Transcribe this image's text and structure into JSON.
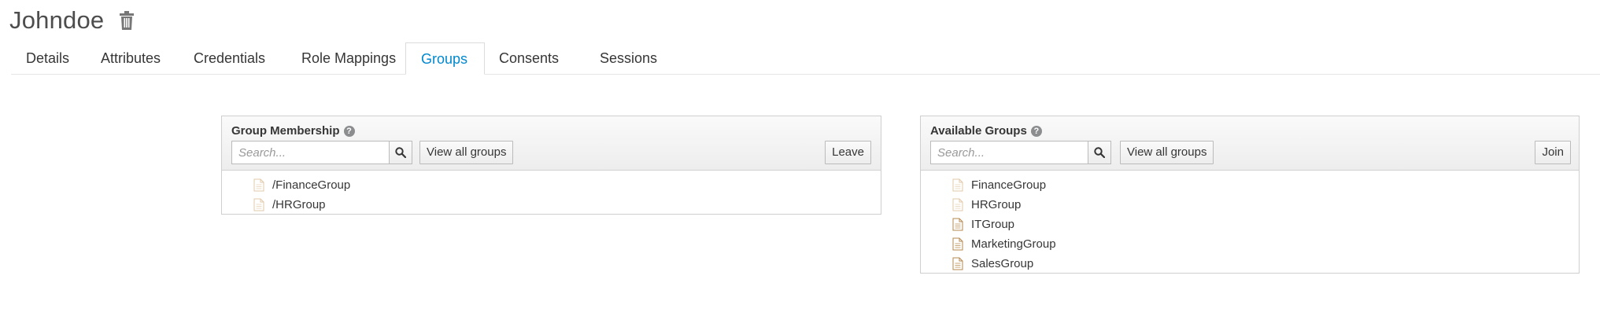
{
  "header": {
    "title": "Johndoe",
    "delete_icon": "trash-icon"
  },
  "tabs": [
    {
      "label": "Details",
      "active": false
    },
    {
      "label": "Attributes",
      "active": false
    },
    {
      "label": "Credentials",
      "active": false
    },
    {
      "label": "Role Mappings",
      "active": false
    },
    {
      "label": "Groups",
      "active": true
    },
    {
      "label": "Consents",
      "active": false
    },
    {
      "label": "Sessions",
      "active": false
    }
  ],
  "membership": {
    "title": "Group Membership",
    "search_placeholder": "Search...",
    "view_all_label": "View all groups",
    "action_label": "Leave",
    "items": [
      "/FinanceGroup",
      "/HRGroup"
    ]
  },
  "available": {
    "title": "Available Groups",
    "search_placeholder": "Search...",
    "view_all_label": "View all groups",
    "action_label": "Join",
    "items": [
      "FinanceGroup",
      "HRGroup",
      "ITGroup",
      "MarketingGroup",
      "SalesGroup"
    ]
  },
  "colors": {
    "accent": "#0088ce",
    "text": "#363636",
    "border": "#cfcfcf"
  }
}
